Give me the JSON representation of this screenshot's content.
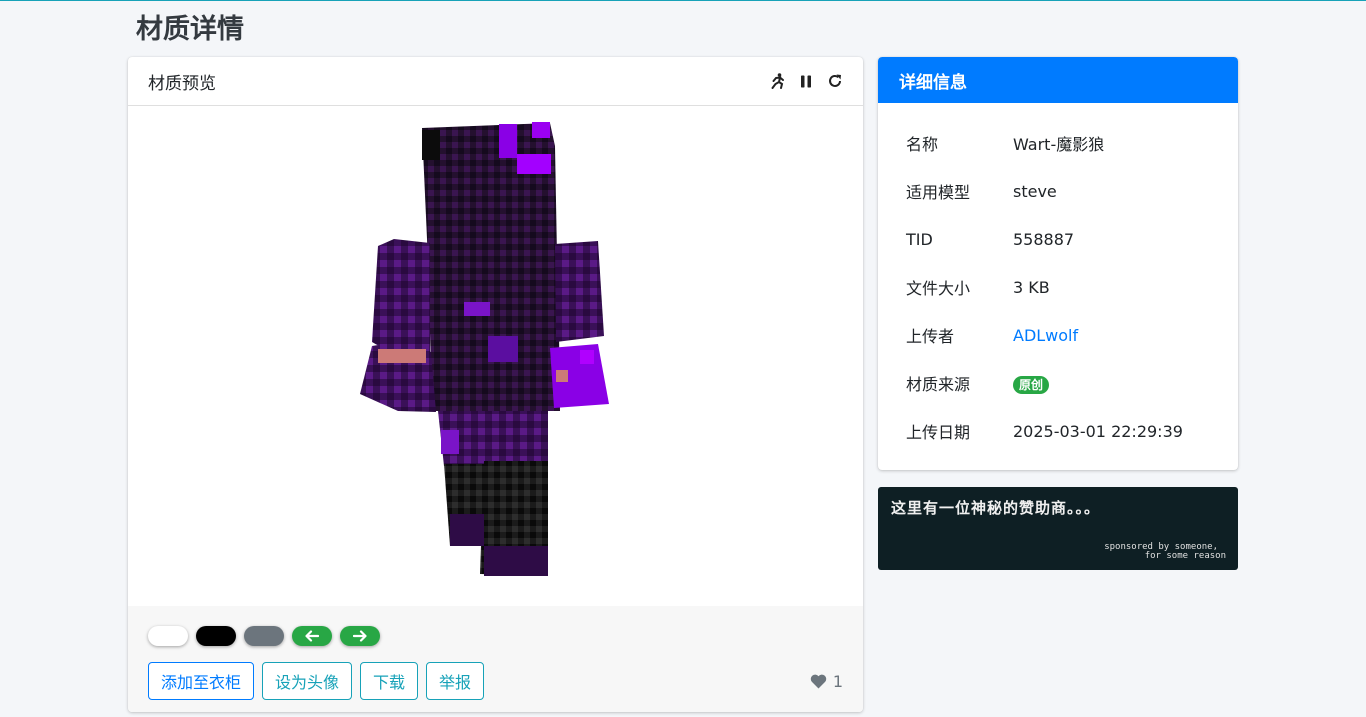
{
  "page": {
    "title": "材质详情"
  },
  "preview": {
    "title": "材质预览",
    "tools": [
      "running-icon",
      "pause-icon",
      "reset-icon"
    ],
    "backgrounds": [
      {
        "name": "white",
        "color": "#ffffff"
      },
      {
        "name": "black",
        "color": "#000000"
      },
      {
        "name": "gray",
        "color": "#6c757d"
      }
    ],
    "nav_icons": [
      "arrow-left-icon",
      "arrow-right-icon"
    ],
    "actions": {
      "add_closet": "添加至衣柜",
      "set_avatar": "设为头像",
      "download": "下载",
      "report": "举报"
    },
    "likes": "1"
  },
  "details": {
    "title": "详细信息",
    "rows": [
      {
        "label": "名称",
        "value": "Wart-魔影狼"
      },
      {
        "label": "适用模型",
        "value": "steve"
      },
      {
        "label": "TID",
        "value": "558887"
      },
      {
        "label": "文件大小",
        "value": "3 KB"
      },
      {
        "label": "上传者",
        "value": "ADLwolf"
      },
      {
        "label": "材质来源",
        "value": "原创"
      },
      {
        "label": "上传日期",
        "value": "2025-03-01 22:29:39"
      }
    ]
  },
  "sponsor": {
    "text": "这里有一位神秘的赞助商。。。",
    "small_line1": "sponsored by someone,",
    "small_line2": "for some reason"
  },
  "colors": {
    "primary": "#007bff",
    "info": "#17a2b8",
    "success": "#28a745",
    "skin_dark": "#1a0a24",
    "skin_purple": "#8a00e6"
  }
}
